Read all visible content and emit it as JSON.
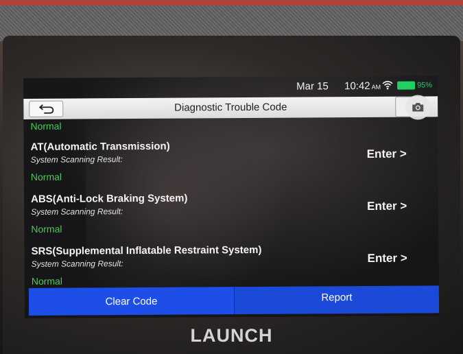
{
  "status_bar": {
    "date": "Mar 15",
    "time": "10:42",
    "ampm": "AM",
    "battery": "95%",
    "wifi_icon": "wifi-icon",
    "battery_icon": "battery-icon"
  },
  "header": {
    "title": "Diagnostic Trouble Code",
    "back_icon": "back-arrow-icon",
    "camera_icon": "camera-icon"
  },
  "list": {
    "partial_status": "Normal",
    "systems": [
      {
        "name": "AT(Automatic Transmission)",
        "result_label": "System Scanning Result:",
        "status": "Normal",
        "enter_label": "Enter >"
      },
      {
        "name": "ABS(Anti-Lock Braking System)",
        "result_label": "System Scanning Result:",
        "status": "Normal",
        "enter_label": "Enter >"
      },
      {
        "name": "SRS(Supplemental Inflatable Restraint System)",
        "result_label": "System Scanning Result:",
        "status": "Normal",
        "enter_label": "Enter >"
      }
    ]
  },
  "footer": {
    "clear_code_label": "Clear Code",
    "report_label": "Report"
  },
  "device": {
    "brand": "LAUNCH"
  },
  "colors": {
    "accent_blue": "#1d4fe8",
    "status_green": "#4ec95a",
    "battery_green": "#20d060"
  }
}
